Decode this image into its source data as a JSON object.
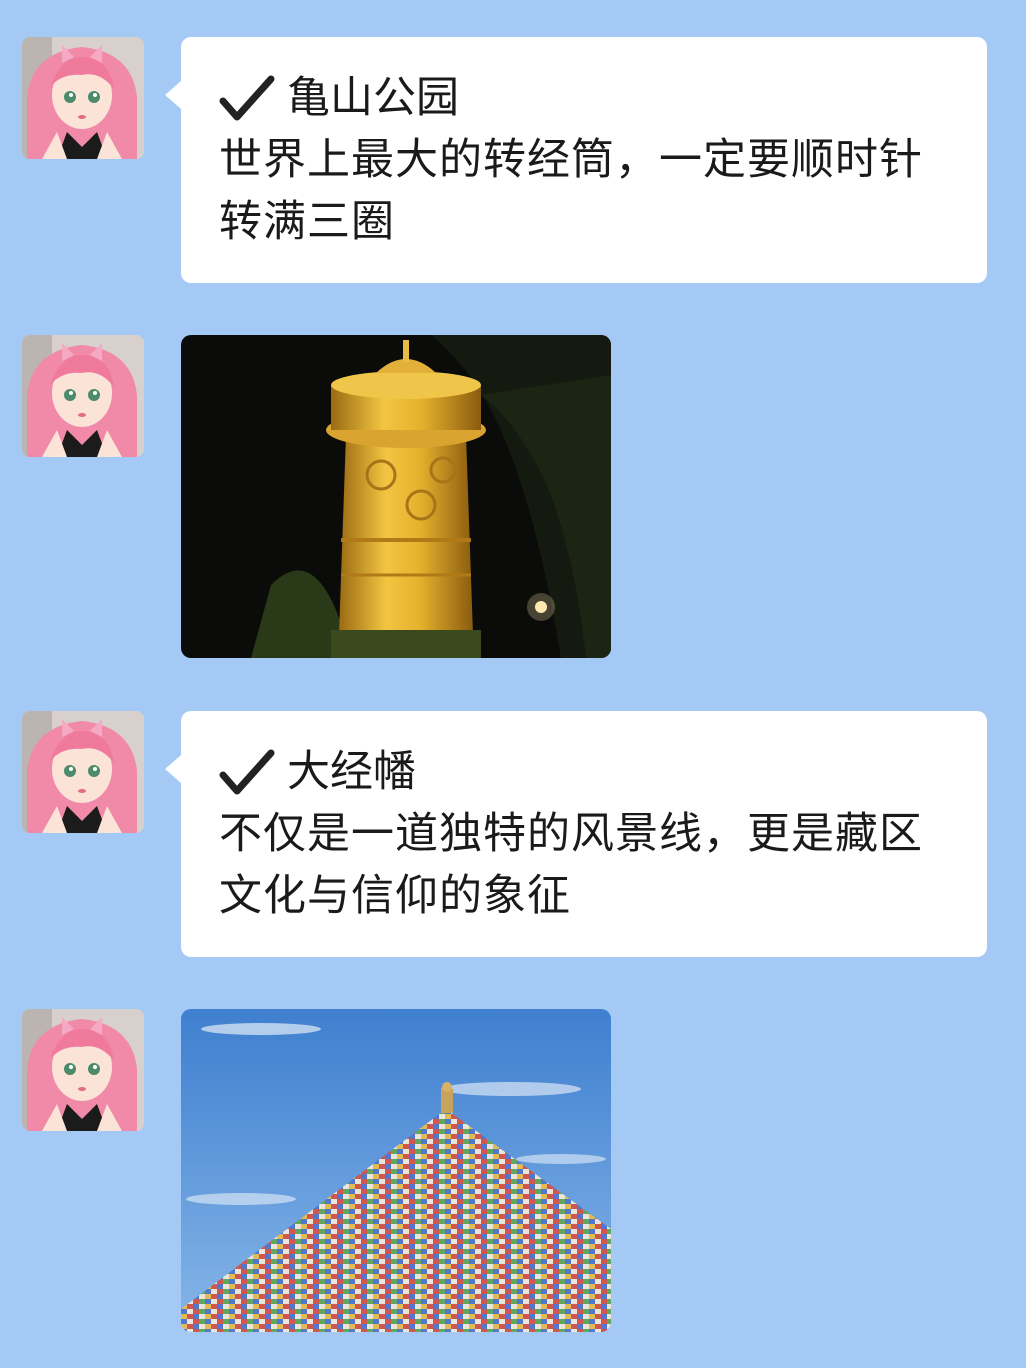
{
  "messages": [
    {
      "type": "text",
      "title": "亀山公园",
      "body": "世界上最大的转经筒，一定要顺时针转满三圈"
    },
    {
      "type": "image",
      "icon": "prayer-wheel-night-photo"
    },
    {
      "type": "text",
      "title": "大经幡",
      "body": "不仅是一道独特的风景线，更是藏区文化与信仰的象征"
    },
    {
      "type": "image",
      "icon": "prayer-flag-stupa-photo"
    }
  ],
  "colors": {
    "background": "#a4c9f4",
    "bubble": "#ffffff",
    "text": "#1a1a1a"
  }
}
